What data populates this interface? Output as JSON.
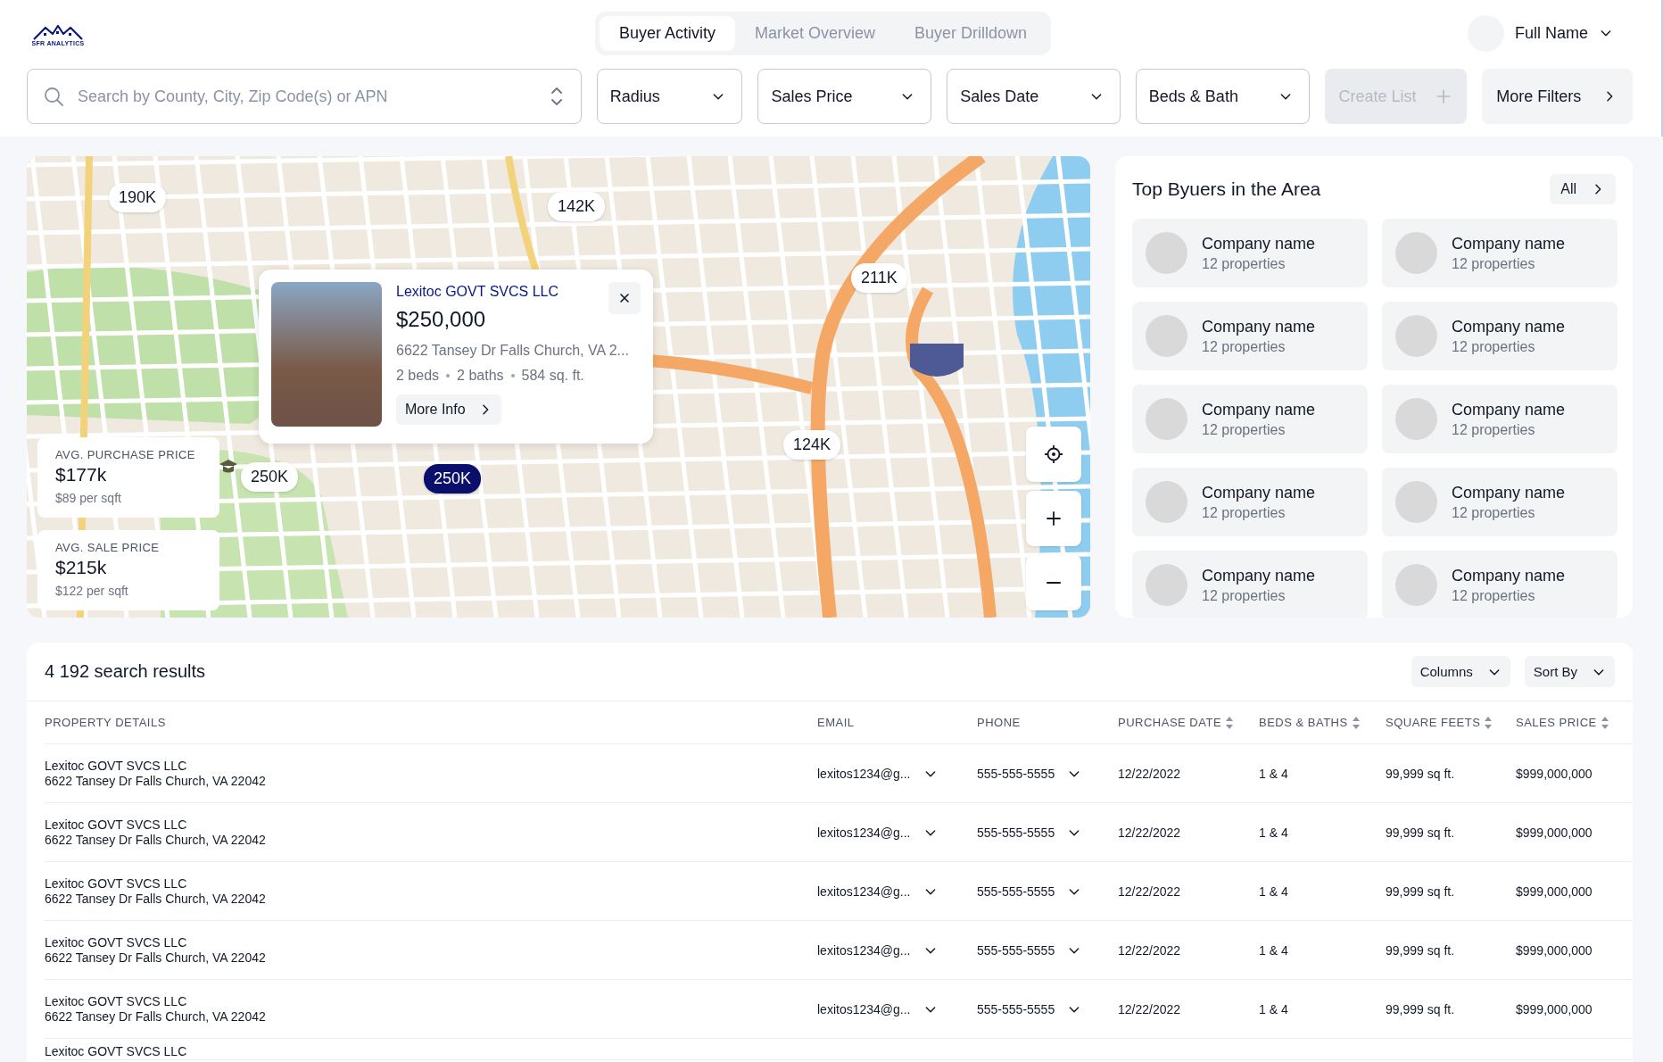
{
  "header": {
    "logo_text": "SFR ANALYTICS",
    "tabs": [
      {
        "label": "Buyer Activity",
        "selected": true
      },
      {
        "label": "Market Overview",
        "selected": false
      },
      {
        "label": "Buyer Drilldown",
        "selected": false
      }
    ],
    "user": {
      "name": "Full Name"
    }
  },
  "filters": {
    "search": {
      "placeholder": "Search by County, City, Zip Code(s) or APN"
    },
    "dropdowns": [
      "Radius",
      "Sales Price",
      "Sales Date",
      "Beds & Bath"
    ],
    "create_list": {
      "label": "Create List",
      "disabled": true
    },
    "more_filters": "More Filters"
  },
  "map": {
    "markers": [
      {
        "label": "190K",
        "selected": false
      },
      {
        "label": "142K",
        "selected": false
      },
      {
        "label": "211K",
        "selected": false
      },
      {
        "label": "124K",
        "selected": false
      },
      {
        "label": "250K",
        "selected": false
      },
      {
        "label": "250K",
        "selected": true
      }
    ],
    "popup": {
      "company": "Lexitoc GOVT SVCS LLC",
      "price": "$250,000",
      "address": "6622 Tansey Dr Falls Church, VA 2...",
      "facts": [
        "2 beds",
        "2 baths",
        "584 sq. ft."
      ],
      "button": "More Info"
    },
    "stats": [
      {
        "label": "AVG. PURCHASE PRICE",
        "value": "$177k",
        "sub": "$89 per sqft"
      },
      {
        "label": "AVG. SALE PRICE",
        "value": "$215k",
        "sub": "$122 per sqft"
      }
    ]
  },
  "top_buyers": {
    "title": "Top Byuers in the Area",
    "all_button": "All",
    "buyers": [
      {
        "name": "Company name",
        "count": "12 properties"
      },
      {
        "name": "Company name",
        "count": "12 properties"
      },
      {
        "name": "Company name",
        "count": "12 properties"
      },
      {
        "name": "Company name",
        "count": "12 properties"
      },
      {
        "name": "Company name",
        "count": "12 properties"
      },
      {
        "name": "Company name",
        "count": "12 properties"
      },
      {
        "name": "Company name",
        "count": "12 properties"
      },
      {
        "name": "Company name",
        "count": "12 properties"
      },
      {
        "name": "Company name",
        "count": "12 properties"
      },
      {
        "name": "Company name",
        "count": "12 properties"
      }
    ]
  },
  "results": {
    "title": "4 192 search results",
    "columns_button": "Columns",
    "sort_button": "Sort By",
    "columns": [
      {
        "label": "PROPERTY DETAILS",
        "sortable": false
      },
      {
        "label": "EMAIL",
        "sortable": false
      },
      {
        "label": "PHONE",
        "sortable": false
      },
      {
        "label": "PURCHASE DATE",
        "sortable": true
      },
      {
        "label": "BEDS & BATHS",
        "sortable": true
      },
      {
        "label": "SQUARE FEETS",
        "sortable": true
      },
      {
        "label": "SALES PRICE",
        "sortable": true
      }
    ],
    "rows": [
      {
        "name": "Lexitoc GOVT SVCS LLC",
        "address": "6622 Tansey Dr Falls Church, VA 22042",
        "email": "lexitos1234@g...",
        "phone": "555-555-5555",
        "date": "12/22/2022",
        "beds_baths": "1 & 4",
        "sqft": "99,999 sq ft.",
        "price": "$999,000,000"
      },
      {
        "name": "Lexitoc GOVT SVCS LLC",
        "address": "6622 Tansey Dr Falls Church, VA 22042",
        "email": "lexitos1234@g...",
        "phone": "555-555-5555",
        "date": "12/22/2022",
        "beds_baths": "1 & 4",
        "sqft": "99,999 sq ft.",
        "price": "$999,000,000"
      },
      {
        "name": "Lexitoc GOVT SVCS LLC",
        "address": "6622 Tansey Dr Falls Church, VA 22042",
        "email": "lexitos1234@g...",
        "phone": "555-555-5555",
        "date": "12/22/2022",
        "beds_baths": "1 & 4",
        "sqft": "99,999 sq ft.",
        "price": "$999,000,000"
      },
      {
        "name": "Lexitoc GOVT SVCS LLC",
        "address": "6622 Tansey Dr Falls Church, VA 22042",
        "email": "lexitos1234@g...",
        "phone": "555-555-5555",
        "date": "12/22/2022",
        "beds_baths": "1 & 4",
        "sqft": "99,999 sq ft.",
        "price": "$999,000,000"
      },
      {
        "name": "Lexitoc GOVT SVCS LLC",
        "address": "6622 Tansey Dr Falls Church, VA 22042",
        "email": "lexitos1234@g...",
        "phone": "555-555-5555",
        "date": "12/22/2022",
        "beds_baths": "1 & 4",
        "sqft": "99,999 sq ft.",
        "price": "$999,000,000"
      },
      {
        "name": "Lexitoc GOVT SVCS LLC"
      }
    ]
  }
}
